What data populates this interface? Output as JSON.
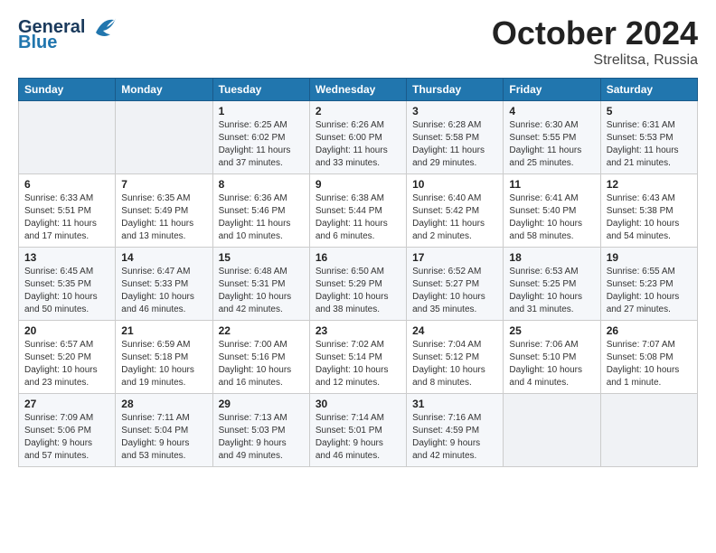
{
  "header": {
    "logo_line1": "General",
    "logo_line2": "Blue",
    "month": "October 2024",
    "location": "Strelitsa, Russia"
  },
  "weekdays": [
    "Sunday",
    "Monday",
    "Tuesday",
    "Wednesday",
    "Thursday",
    "Friday",
    "Saturday"
  ],
  "weeks": [
    [
      {
        "day": "",
        "sunrise": "",
        "sunset": "",
        "daylight": ""
      },
      {
        "day": "",
        "sunrise": "",
        "sunset": "",
        "daylight": ""
      },
      {
        "day": "1",
        "sunrise": "Sunrise: 6:25 AM",
        "sunset": "Sunset: 6:02 PM",
        "daylight": "Daylight: 11 hours and 37 minutes."
      },
      {
        "day": "2",
        "sunrise": "Sunrise: 6:26 AM",
        "sunset": "Sunset: 6:00 PM",
        "daylight": "Daylight: 11 hours and 33 minutes."
      },
      {
        "day": "3",
        "sunrise": "Sunrise: 6:28 AM",
        "sunset": "Sunset: 5:58 PM",
        "daylight": "Daylight: 11 hours and 29 minutes."
      },
      {
        "day": "4",
        "sunrise": "Sunrise: 6:30 AM",
        "sunset": "Sunset: 5:55 PM",
        "daylight": "Daylight: 11 hours and 25 minutes."
      },
      {
        "day": "5",
        "sunrise": "Sunrise: 6:31 AM",
        "sunset": "Sunset: 5:53 PM",
        "daylight": "Daylight: 11 hours and 21 minutes."
      }
    ],
    [
      {
        "day": "6",
        "sunrise": "Sunrise: 6:33 AM",
        "sunset": "Sunset: 5:51 PM",
        "daylight": "Daylight: 11 hours and 17 minutes."
      },
      {
        "day": "7",
        "sunrise": "Sunrise: 6:35 AM",
        "sunset": "Sunset: 5:49 PM",
        "daylight": "Daylight: 11 hours and 13 minutes."
      },
      {
        "day": "8",
        "sunrise": "Sunrise: 6:36 AM",
        "sunset": "Sunset: 5:46 PM",
        "daylight": "Daylight: 11 hours and 10 minutes."
      },
      {
        "day": "9",
        "sunrise": "Sunrise: 6:38 AM",
        "sunset": "Sunset: 5:44 PM",
        "daylight": "Daylight: 11 hours and 6 minutes."
      },
      {
        "day": "10",
        "sunrise": "Sunrise: 6:40 AM",
        "sunset": "Sunset: 5:42 PM",
        "daylight": "Daylight: 11 hours and 2 minutes."
      },
      {
        "day": "11",
        "sunrise": "Sunrise: 6:41 AM",
        "sunset": "Sunset: 5:40 PM",
        "daylight": "Daylight: 10 hours and 58 minutes."
      },
      {
        "day": "12",
        "sunrise": "Sunrise: 6:43 AM",
        "sunset": "Sunset: 5:38 PM",
        "daylight": "Daylight: 10 hours and 54 minutes."
      }
    ],
    [
      {
        "day": "13",
        "sunrise": "Sunrise: 6:45 AM",
        "sunset": "Sunset: 5:35 PM",
        "daylight": "Daylight: 10 hours and 50 minutes."
      },
      {
        "day": "14",
        "sunrise": "Sunrise: 6:47 AM",
        "sunset": "Sunset: 5:33 PM",
        "daylight": "Daylight: 10 hours and 46 minutes."
      },
      {
        "day": "15",
        "sunrise": "Sunrise: 6:48 AM",
        "sunset": "Sunset: 5:31 PM",
        "daylight": "Daylight: 10 hours and 42 minutes."
      },
      {
        "day": "16",
        "sunrise": "Sunrise: 6:50 AM",
        "sunset": "Sunset: 5:29 PM",
        "daylight": "Daylight: 10 hours and 38 minutes."
      },
      {
        "day": "17",
        "sunrise": "Sunrise: 6:52 AM",
        "sunset": "Sunset: 5:27 PM",
        "daylight": "Daylight: 10 hours and 35 minutes."
      },
      {
        "day": "18",
        "sunrise": "Sunrise: 6:53 AM",
        "sunset": "Sunset: 5:25 PM",
        "daylight": "Daylight: 10 hours and 31 minutes."
      },
      {
        "day": "19",
        "sunrise": "Sunrise: 6:55 AM",
        "sunset": "Sunset: 5:23 PM",
        "daylight": "Daylight: 10 hours and 27 minutes."
      }
    ],
    [
      {
        "day": "20",
        "sunrise": "Sunrise: 6:57 AM",
        "sunset": "Sunset: 5:20 PM",
        "daylight": "Daylight: 10 hours and 23 minutes."
      },
      {
        "day": "21",
        "sunrise": "Sunrise: 6:59 AM",
        "sunset": "Sunset: 5:18 PM",
        "daylight": "Daylight: 10 hours and 19 minutes."
      },
      {
        "day": "22",
        "sunrise": "Sunrise: 7:00 AM",
        "sunset": "Sunset: 5:16 PM",
        "daylight": "Daylight: 10 hours and 16 minutes."
      },
      {
        "day": "23",
        "sunrise": "Sunrise: 7:02 AM",
        "sunset": "Sunset: 5:14 PM",
        "daylight": "Daylight: 10 hours and 12 minutes."
      },
      {
        "day": "24",
        "sunrise": "Sunrise: 7:04 AM",
        "sunset": "Sunset: 5:12 PM",
        "daylight": "Daylight: 10 hours and 8 minutes."
      },
      {
        "day": "25",
        "sunrise": "Sunrise: 7:06 AM",
        "sunset": "Sunset: 5:10 PM",
        "daylight": "Daylight: 10 hours and 4 minutes."
      },
      {
        "day": "26",
        "sunrise": "Sunrise: 7:07 AM",
        "sunset": "Sunset: 5:08 PM",
        "daylight": "Daylight: 10 hours and 1 minute."
      }
    ],
    [
      {
        "day": "27",
        "sunrise": "Sunrise: 7:09 AM",
        "sunset": "Sunset: 5:06 PM",
        "daylight": "Daylight: 9 hours and 57 minutes."
      },
      {
        "day": "28",
        "sunrise": "Sunrise: 7:11 AM",
        "sunset": "Sunset: 5:04 PM",
        "daylight": "Daylight: 9 hours and 53 minutes."
      },
      {
        "day": "29",
        "sunrise": "Sunrise: 7:13 AM",
        "sunset": "Sunset: 5:03 PM",
        "daylight": "Daylight: 9 hours and 49 minutes."
      },
      {
        "day": "30",
        "sunrise": "Sunrise: 7:14 AM",
        "sunset": "Sunset: 5:01 PM",
        "daylight": "Daylight: 9 hours and 46 minutes."
      },
      {
        "day": "31",
        "sunrise": "Sunrise: 7:16 AM",
        "sunset": "Sunset: 4:59 PM",
        "daylight": "Daylight: 9 hours and 42 minutes."
      },
      {
        "day": "",
        "sunrise": "",
        "sunset": "",
        "daylight": ""
      },
      {
        "day": "",
        "sunrise": "",
        "sunset": "",
        "daylight": ""
      }
    ]
  ]
}
